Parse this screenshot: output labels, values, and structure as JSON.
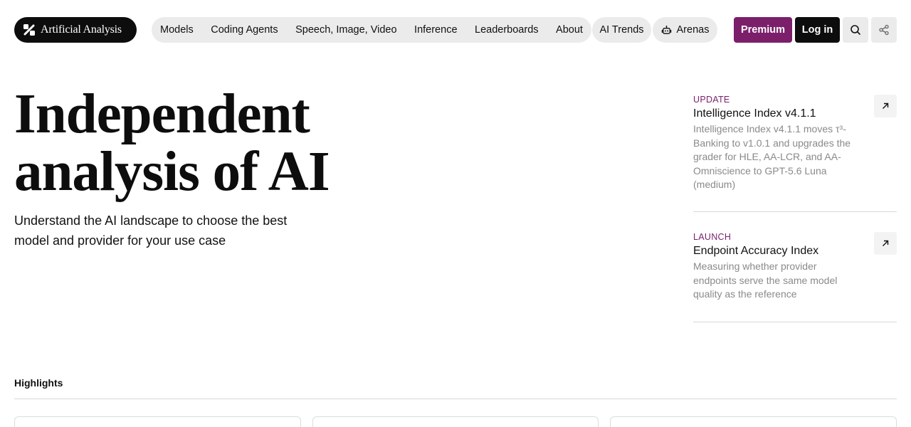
{
  "header": {
    "logo_text": "Artificial Analysis",
    "nav_main": [
      "Models",
      "Coding Agents",
      "Speech, Image, Video",
      "Inference",
      "Leaderboards",
      "About"
    ],
    "nav_trends": "AI Trends",
    "nav_arenas": "Arenas",
    "premium_label": "Premium",
    "login_label": "Log in"
  },
  "hero": {
    "title_line1": "Independent",
    "title_line2": "analysis of AI",
    "subtitle": "Understand the AI landscape to choose the best model and provider for your use case"
  },
  "news": [
    {
      "tag": "UPDATE",
      "title": "Intelligence Index v4.1.1",
      "description": "Intelligence Index v4.1.1 moves τ³-Banking to v1.0.1 and upgrades the grader for HLE, AA-LCR, and AA-Omniscience to GPT-5.6 Luna (medium)"
    },
    {
      "tag": "LAUNCH",
      "title": "Endpoint Accuracy Index",
      "description": "Measuring whether provider endpoints serve the same model quality as the reference"
    }
  ],
  "highlights": {
    "label": "Highlights"
  },
  "colors": {
    "accent": "#7b1f6b",
    "dark": "#0d0d0d",
    "pill": "#ebebeb",
    "muted_text": "#8a8a8a"
  }
}
